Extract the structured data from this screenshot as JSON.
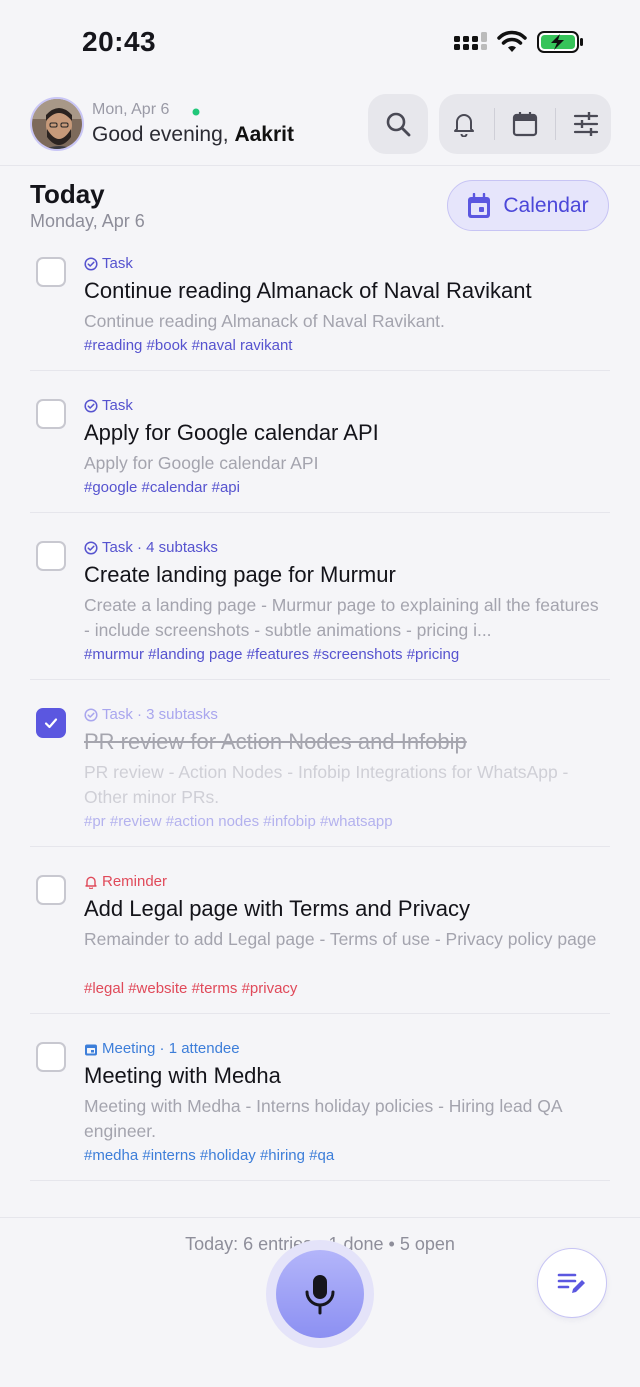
{
  "status_bar": {
    "time": "20:43"
  },
  "header": {
    "date": "Mon, Apr 6",
    "greeting": "Good evening,",
    "user_name": "Aakrit",
    "icons": [
      "search-icon",
      "bell-icon",
      "calendar-icon",
      "sliders-icon"
    ]
  },
  "today": {
    "title": "Today",
    "subtitle": "Monday, Apr 6",
    "calendar_button": "Calendar"
  },
  "items": [
    {
      "type": "Task",
      "meta": "Task",
      "title": "Continue reading Almanack of Naval Ravikant",
      "description": "Continue reading Almanack of Naval Ravikant.",
      "tags": "#reading #book #naval ravikant",
      "done": false
    },
    {
      "type": "Task",
      "meta": "Task",
      "title": "Apply for Google calendar API",
      "description": "Apply for Google calendar API",
      "tags": "#google #calendar #api",
      "done": false
    },
    {
      "type": "Task",
      "meta": "Task · 4 subtasks",
      "title": "Create landing page for Murmur",
      "description": "Create a landing page - Murmur page to explaining all the features - include screenshots - subtle animations - pricing i...",
      "tags": "#murmur #landing page #features #screenshots #pricing",
      "done": false
    },
    {
      "type": "Task",
      "meta": "Task · 3 subtasks",
      "title": "PR review for Action Nodes and Infobip",
      "description": "PR review - Action Nodes - Infobip Integrations for WhatsApp - Other minor PRs.",
      "tags": "#pr #review #action nodes #infobip #whatsapp",
      "done": true
    },
    {
      "type": "Reminder",
      "meta": "Reminder",
      "title": "Add Legal page with Terms and Privacy",
      "description": "Remainder to add Legal page - Terms of use - Privacy policy page",
      "tags": "#legal #website #terms #privacy",
      "done": false
    },
    {
      "type": "Meeting",
      "meta": "Meeting · 1 attendee",
      "title": "Meeting with Medha",
      "description": "Meeting with Medha - Interns holiday policies - Hiring lead QA engineer.",
      "tags": "#medha #interns #holiday #hiring #qa",
      "done": false
    }
  ],
  "footer": {
    "summary": "Today: 6 entries • 1 done • 5 open"
  },
  "colors": {
    "accent": "#5b57e0",
    "reminder": "#e04a5a",
    "meeting": "#3d7ed9",
    "background": "#f5f5f8"
  }
}
